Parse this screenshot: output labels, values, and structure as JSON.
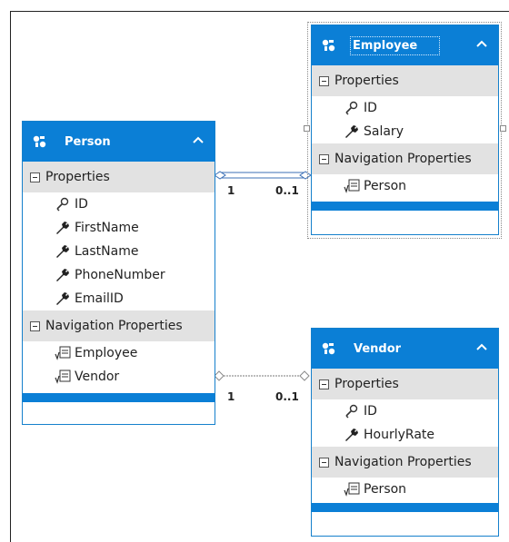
{
  "entities": {
    "person": {
      "title": "Person",
      "properties_header": "Properties",
      "properties": [
        "ID",
        "FirstName",
        "LastName",
        "PhoneNumber",
        "EmailID"
      ],
      "nav_header": "Navigation Properties",
      "nav": [
        "Employee",
        "Vendor"
      ]
    },
    "employee": {
      "title": "Employee",
      "properties_header": "Properties",
      "properties": [
        "ID",
        "Salary"
      ],
      "nav_header": "Navigation Properties",
      "nav": [
        "Person"
      ]
    },
    "vendor": {
      "title": "Vendor",
      "properties_header": "Properties",
      "properties": [
        "ID",
        "HourlyRate"
      ],
      "nav_header": "Navigation Properties",
      "nav": [
        "Person"
      ]
    }
  },
  "associations": {
    "person_employee": {
      "left": "1",
      "right": "0..1"
    },
    "person_vendor": {
      "left": "1",
      "right": "0..1"
    }
  },
  "colors": {
    "header": "#0b7fd6",
    "section": "#e2e2e2",
    "border": "#1580cc"
  }
}
